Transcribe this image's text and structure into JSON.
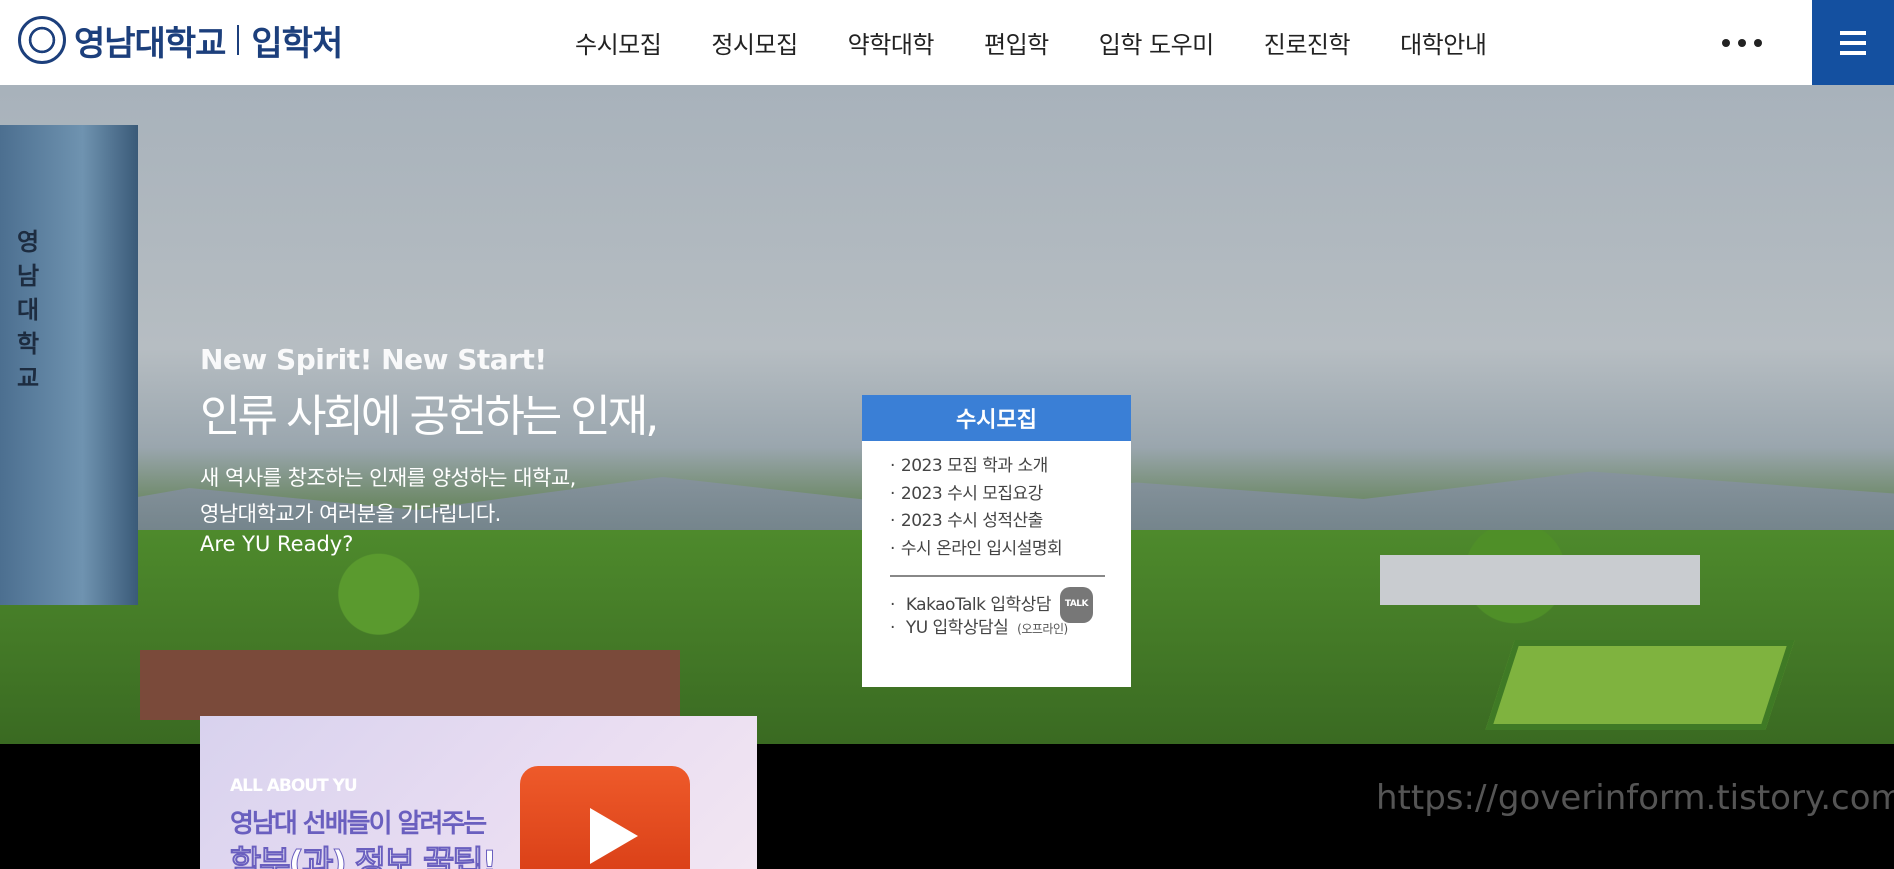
{
  "header": {
    "logo_name": "영남대학교",
    "logo_sub": "입학처",
    "nav": [
      "수시모집",
      "정시모집",
      "약학대학",
      "편입학",
      "입학 도우미",
      "진로진학",
      "대학안내"
    ],
    "brand_color": "#1c3f7c",
    "menu_color": "#1450a0"
  },
  "hero": {
    "tower_sign": "영남대학교",
    "slogan_en": "New Spirit! New Start!",
    "slogan_ko": "인류 사회에 공헌하는 인재,",
    "desc_line1": "새 역사를 창조하는 인재를 양성하는 대학교,",
    "desc_line2": "영남대학교가 여러분을 기다립니다.",
    "ready": "Are YU Ready?"
  },
  "card": {
    "title": "수시모집",
    "links": [
      "2023 모집 학과 소개",
      "2023 수시 모집요강",
      "2023 수시 성적산출",
      "수시 온라인 입시설명회"
    ],
    "kakao": "KakaoTalk 입학상담",
    "talk_badge": "TALK",
    "office": "YU 입학상담실",
    "office_note": "(오프라인)",
    "accent": "#3a7fd6"
  },
  "video": {
    "tag": "ALL ABOUT YU",
    "line1": "영남대 선배들이 알려주는",
    "line2": "학부(과) 정보 꿀팁!"
  },
  "watermark": "https://goverinform.tistory.com"
}
